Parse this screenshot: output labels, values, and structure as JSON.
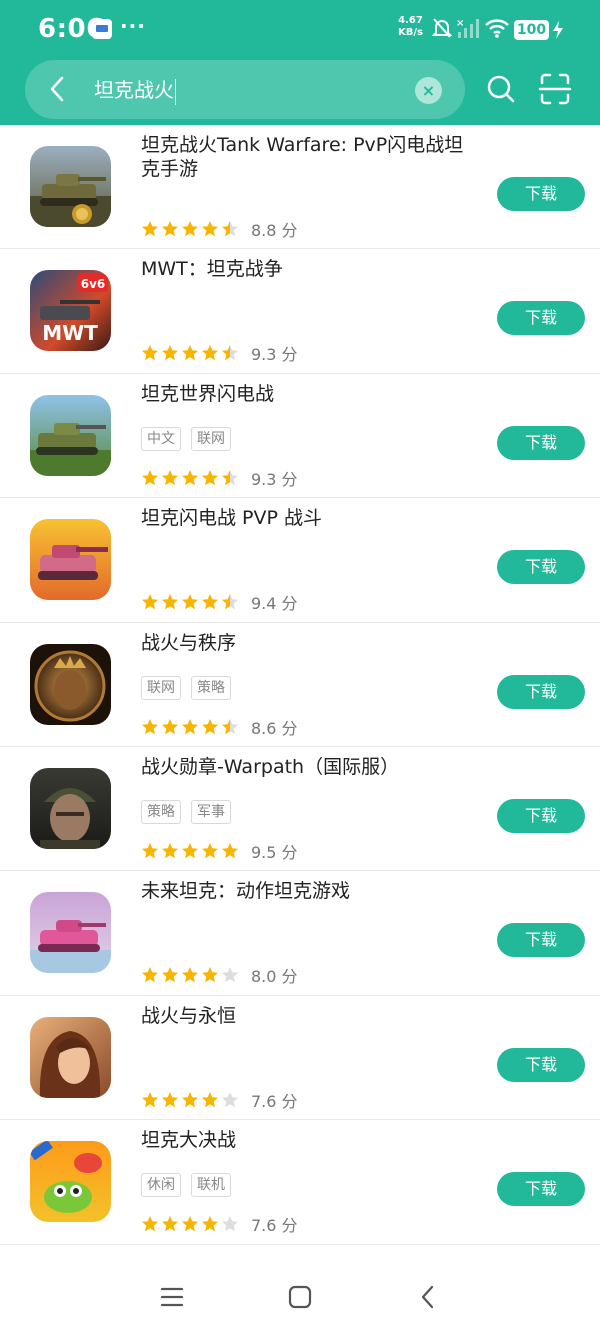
{
  "status": {
    "time": "6:06",
    "net_speed_value": "4.67",
    "net_speed_unit": "KB/s",
    "battery": "100"
  },
  "search": {
    "query": "坦克战火"
  },
  "apps": [
    {
      "name": "坦克战火Tank Warfare: PvP闪电战坦克手游",
      "tags": [],
      "rating": 4.5,
      "score": "8.8 分",
      "download_label": "下载"
    },
    {
      "name": "MWT：坦克战争",
      "tags": [],
      "rating": 4.5,
      "score": "9.3 分",
      "download_label": "下载"
    },
    {
      "name": "坦克世界闪电战",
      "tags": [
        "中文",
        "联网"
      ],
      "rating": 4.5,
      "score": "9.3 分",
      "download_label": "下载"
    },
    {
      "name": "坦克闪电战 PVP 战斗",
      "tags": [],
      "rating": 4.5,
      "score": "9.4 分",
      "download_label": "下载"
    },
    {
      "name": "战火与秩序",
      "tags": [
        "联网",
        "策略"
      ],
      "rating": 4.5,
      "score": "8.6 分",
      "download_label": "下载"
    },
    {
      "name": "战火勋章-Warpath（国际服）",
      "tags": [
        "策略",
        "军事"
      ],
      "rating": 5,
      "score": "9.5 分",
      "download_label": "下载"
    },
    {
      "name": "未来坦克：动作坦克游戏",
      "tags": [],
      "rating": 4,
      "score": "8.0 分",
      "download_label": "下载"
    },
    {
      "name": "战火与永恒",
      "tags": [],
      "rating": 4,
      "score": "7.6 分",
      "download_label": "下载"
    },
    {
      "name": "坦克大决战",
      "tags": [
        "休闲",
        "联机"
      ],
      "rating": 4,
      "score": "7.6 分",
      "download_label": "下载"
    }
  ],
  "colors": {
    "accent": "#22b99a",
    "star": "#f7b500",
    "star_empty": "#dddddd"
  },
  "icons": {
    "app_icons": [
      "tank-warfare-icon",
      "mwt-icon",
      "wot-blitz-icon",
      "tank-blitz-icon",
      "war-and-order-icon",
      "warpath-icon",
      "future-tanks-icon",
      "war-eternity-icon",
      "tank-battle-icon"
    ]
  }
}
